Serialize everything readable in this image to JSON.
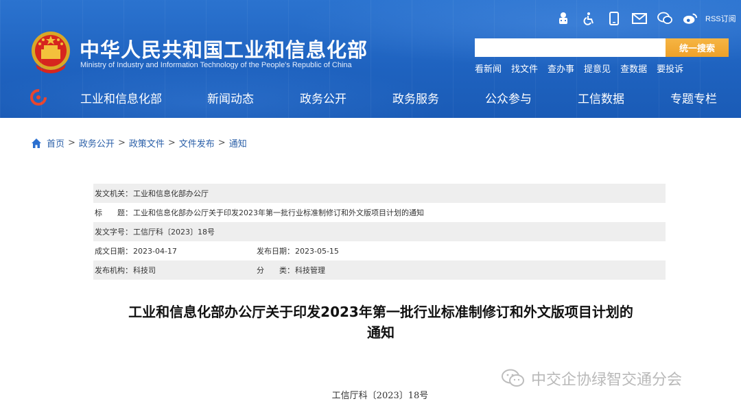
{
  "header": {
    "title_cn": "中华人民共和国工业和信息化部",
    "title_en": "Ministry of Industry and Information Technology of the People's Republic of China",
    "util_icons": [
      "robot-icon",
      "accessibility-icon",
      "mobile-icon",
      "mail-icon",
      "wechat-icon",
      "weibo-icon"
    ],
    "rss_label": "RSS订阅",
    "search": {
      "value": "",
      "placeholder": "",
      "button_label": "统一搜索"
    },
    "quick_links": [
      "看新闻",
      "找文件",
      "查办事",
      "提意见",
      "查数据",
      "要投诉"
    ],
    "nav": [
      "工业和信息化部",
      "新闻动态",
      "政务公开",
      "政务服务",
      "公众参与",
      "工信数据",
      "专题专栏"
    ],
    "colors": {
      "header_bg": "#1f63c0",
      "search_button": "#f0a42e"
    }
  },
  "breadcrumb": [
    "首页",
    "政务公开",
    "政策文件",
    "文件发布",
    "通知"
  ],
  "info": {
    "issuer_label": "发文机关：",
    "issuer": "工业和信息化部办公厅",
    "title_label": "标　　题：",
    "title": "工业和信息化部办公厅关于印发2023年第一批行业标准制修订和外文版项目计划的通知",
    "docno_label": "发文字号：",
    "docno": "工信厅科〔2023〕18号",
    "created_label": "成文日期：",
    "created": "2023-04-17",
    "published_label": "发布日期：",
    "published": "2023-05-15",
    "org_label": "发布机构：",
    "org": "科技司",
    "category_label": "分　　类：",
    "category": "科技管理"
  },
  "article": {
    "title_line1": "工业和信息化部办公厅关于印发2023年第一批行业标准制修订和外文版项目计划的",
    "title_line2": "通知",
    "doc_number": "工信厅科〔2023〕18号"
  },
  "watermark": {
    "text": "中交企协绿智交通分会"
  }
}
